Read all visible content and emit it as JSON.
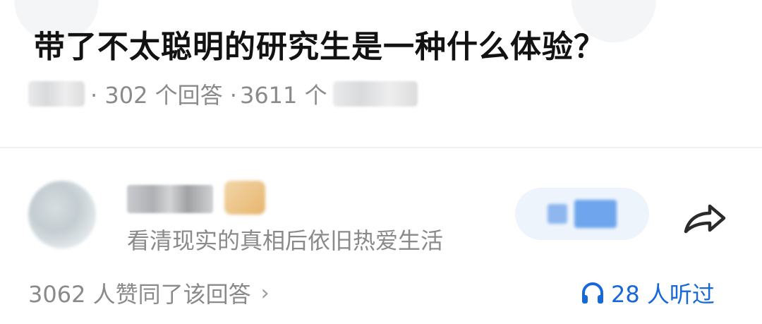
{
  "question": {
    "title": "带了不太聪明的研究生是一种什么体验？",
    "answers": "· 302 个回答 ·",
    "followers_partial": "3611 个"
  },
  "answer": {
    "author_bio": "看清现实的真相后依旧热爱生活",
    "likes": "3062 人赞同了该回答",
    "listeners": "28 人听过"
  },
  "icons": {
    "share": "share-arrow-icon",
    "chevron": "chevron-right-icon",
    "headphones": "headphones-icon"
  },
  "colors": {
    "accent": "#1768d9",
    "muted_text": "#8a8a8a"
  }
}
